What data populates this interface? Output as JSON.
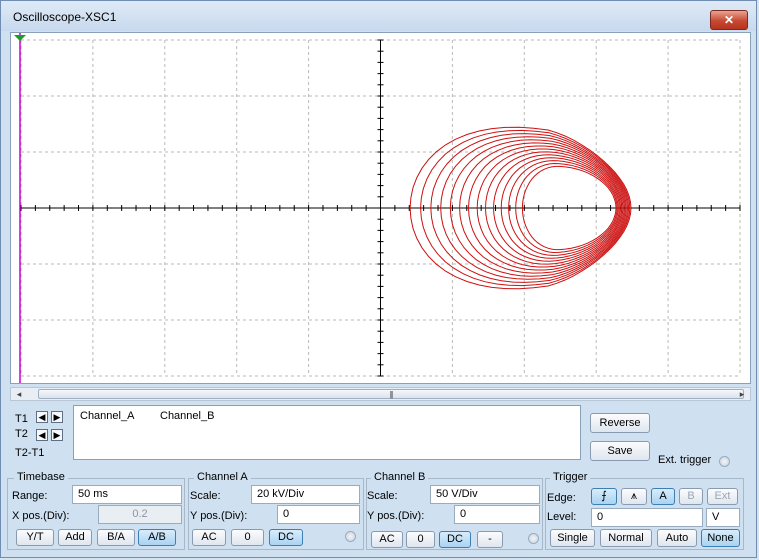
{
  "window": {
    "title": "Oscilloscope-XSC1",
    "close_glyph": "✕",
    "accent_close": "#c74a33"
  },
  "screen": {
    "trace_color": "#cc1111",
    "cursor_color": "#cc00cc",
    "grid": "dashed",
    "trigger_marker_color": "#1a9d2a",
    "trigger_marker_label": "T"
  },
  "scrollbar": {
    "left_arrow": "◂",
    "right_arrow": "▸",
    "grip": "|||"
  },
  "cursors": {
    "t1": "T1",
    "t2": "T2",
    "t2t1": "T2-T1",
    "left_glyph": "◀",
    "right_glyph": "▶"
  },
  "readout": {
    "col1": "Channel_A",
    "col2": "Channel_B"
  },
  "buttons": {
    "reverse": "Reverse",
    "save": "Save",
    "ext_trigger": "Ext. trigger"
  },
  "timebase": {
    "title": "Timebase",
    "range_label": "Range:",
    "range_value": "50 ms",
    "xpos_label": "X pos.(Div):",
    "xpos_value": "0.2",
    "modes": [
      "Y/T",
      "Add",
      "B/A",
      "A/B"
    ],
    "active_mode": "A/B"
  },
  "channel_a": {
    "title": "Channel A",
    "scale_label": "Scale:",
    "scale_value": "20 kV/Div",
    "ypos_label": "Y pos.(Div):",
    "ypos_value": "0",
    "coupling": [
      "AC",
      "0",
      "DC"
    ],
    "active": "DC"
  },
  "channel_b": {
    "title": "Channel B",
    "scale_label": "Scale:",
    "scale_value": "50  V/Div",
    "ypos_label": "Y pos.(Div):",
    "ypos_value": "0",
    "coupling": [
      "AC",
      "0",
      "DC",
      "-"
    ],
    "active": "DC"
  },
  "trigger": {
    "title": "Trigger",
    "edge_label": "Edge:",
    "edge_rise": "⨍",
    "edge_fall": "⩚",
    "sources": [
      "A",
      "B",
      "Ext"
    ],
    "active_source": "A",
    "level_label": "Level:",
    "level_value": "0",
    "level_unit": "V",
    "modes": [
      "Single",
      "Normal",
      "Auto",
      "None"
    ],
    "active_mode": "None"
  }
}
